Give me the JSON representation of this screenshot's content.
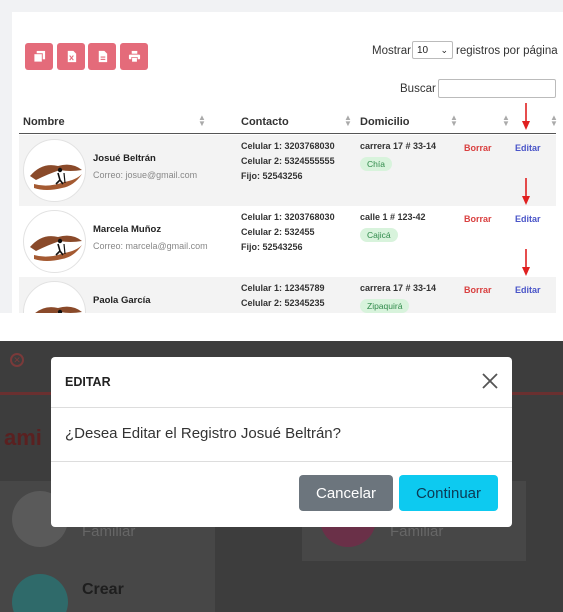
{
  "table": {
    "length_label_before": "Mostrar",
    "length_value": "10",
    "length_label_after": "registros por página",
    "search_label": "Buscar",
    "search_value": "",
    "columns": [
      "Nombre",
      "Contacto",
      "Domicilio"
    ],
    "rows": [
      {
        "name": "Josué Beltrán",
        "email": "Correo: josue@gmail.com",
        "contact": [
          "Celular 1: 3203768030",
          "Celular 2: 5324555555",
          "Fijo: 52543256"
        ],
        "address": "carrera 17 # 33-14",
        "city": "Chía",
        "delete": "Borrar",
        "edit": "Editar"
      },
      {
        "name": "Marcela Muñoz",
        "email": "Correo: marcela@gmail.com",
        "contact": [
          "Celular 1: 3203768030",
          "Celular 2: 532455",
          "Fijo: 52543256"
        ],
        "address": "calle 1 # 123-42",
        "city": "Cajicá",
        "delete": "Borrar",
        "edit": "Editar"
      },
      {
        "name": "Paola García",
        "email": "",
        "contact": [
          "Celular 1: 12345789",
          "Celular 2: 52345235",
          ""
        ],
        "address": "carrera 17 # 33-14",
        "city": "Zipaquirá",
        "delete": "Borrar",
        "edit": "Editar"
      }
    ]
  },
  "background": {
    "heading_partial": "ami",
    "card_labels": [
      "Familiar",
      "Familiar"
    ],
    "create_label": "Crear"
  },
  "modal": {
    "title": "EDITAR",
    "body": "¿Desea Editar el Registro Josué Beltrán?",
    "cancel_label": "Cancelar",
    "continue_label": "Continuar"
  },
  "colors": {
    "export_button": "#e46b7a",
    "delete_link": "#d94040",
    "edit_link": "#4a55c8",
    "badge_bg": "#d8f3dc",
    "cancel_button": "#6c757d",
    "continue_button": "#0dcaf0",
    "annotation_arrow": "#e02020"
  },
  "icons": [
    "copy-icon",
    "excel-icon",
    "pdf-icon",
    "print-icon",
    "sort-icon",
    "close-icon",
    "chevron-down-icon",
    "arrow-down-icon"
  ]
}
